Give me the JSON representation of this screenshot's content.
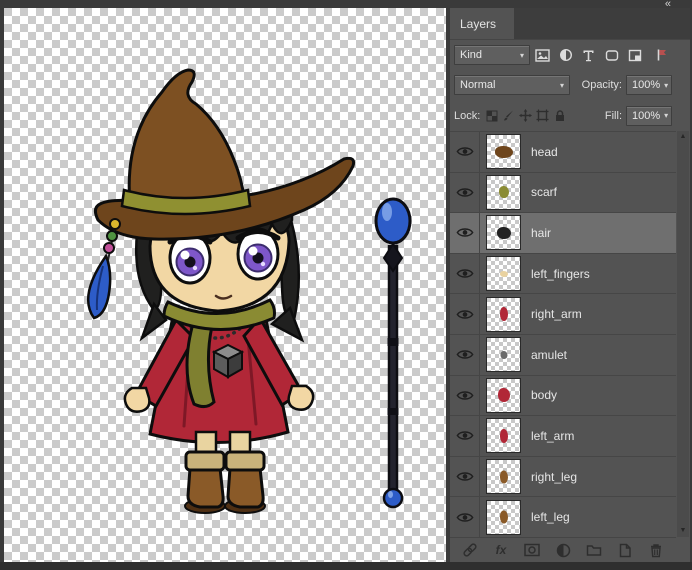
{
  "window": {
    "collapse_button": "«"
  },
  "layers_panel": {
    "tab_label": "Layers",
    "filter_row": {
      "kind_label": "Kind",
      "filter_icons": [
        "pixel-layers",
        "adjustment-layers",
        "type-layers",
        "shape-layers",
        "smart-objects"
      ],
      "filter_toggle": "layer-filter-toggle"
    },
    "blend_row": {
      "blend_mode": "Normal",
      "opacity_label": "Opacity:",
      "opacity_value": "100%"
    },
    "lock_row": {
      "lock_label": "Lock:",
      "lock_icons": [
        "lock-transparency",
        "lock-image",
        "lock-position",
        "lock-artboard",
        "lock-all"
      ],
      "fill_label": "Fill:",
      "fill_value": "100%"
    },
    "icons": {
      "fx_label": "fx",
      "toolbar_icons": [
        "link-layers",
        "layer-styles",
        "add-layer-mask",
        "new-adjustment-layer",
        "new-group",
        "new-layer",
        "delete-layer"
      ]
    },
    "selected_layer": "hair",
    "layers": [
      {
        "name": "head",
        "visible": true,
        "thumb_color": "#6e451c",
        "blob_w": 18,
        "blob_h": 12
      },
      {
        "name": "scarf",
        "visible": true,
        "thumb_color": "#8a8b33",
        "blob_w": 10,
        "blob_h": 12
      },
      {
        "name": "hair",
        "visible": true,
        "thumb_color": "#222222",
        "blob_w": 14,
        "blob_h": 12
      },
      {
        "name": "left_fingers",
        "visible": true,
        "thumb_color": "#e9d2a0",
        "blob_w": 8,
        "blob_h": 6
      },
      {
        "name": "right_arm",
        "visible": true,
        "thumb_color": "#b12737",
        "blob_w": 8,
        "blob_h": 14
      },
      {
        "name": "amulet",
        "visible": true,
        "thumb_color": "#6b6b6b",
        "blob_w": 7,
        "blob_h": 8
      },
      {
        "name": "body",
        "visible": true,
        "thumb_color": "#b12737",
        "blob_w": 12,
        "blob_h": 14
      },
      {
        "name": "left_arm",
        "visible": true,
        "thumb_color": "#b12737",
        "blob_w": 8,
        "blob_h": 14
      },
      {
        "name": "right_leg",
        "visible": true,
        "thumb_color": "#8a5a28",
        "blob_w": 8,
        "blob_h": 13
      },
      {
        "name": "left_leg",
        "visible": true,
        "thumb_color": "#8a5a28",
        "blob_w": 8,
        "blob_h": 13
      }
    ]
  },
  "colors": {
    "panel_bg": "#535353",
    "selected_row": "#6f6f6f",
    "checker_light": "#ffffff",
    "checker_dark": "#cbcbcb",
    "hat_brown": "#7d5022",
    "band_olive": "#8f9031",
    "dress_red": "#b12737",
    "scarf_olive": "#8a8b33",
    "orb_blue": "#2d5cc8",
    "skin_tan": "#f2d7a4",
    "eye_purple": "#7e57c9",
    "boot_brown": "#8a5a28"
  }
}
